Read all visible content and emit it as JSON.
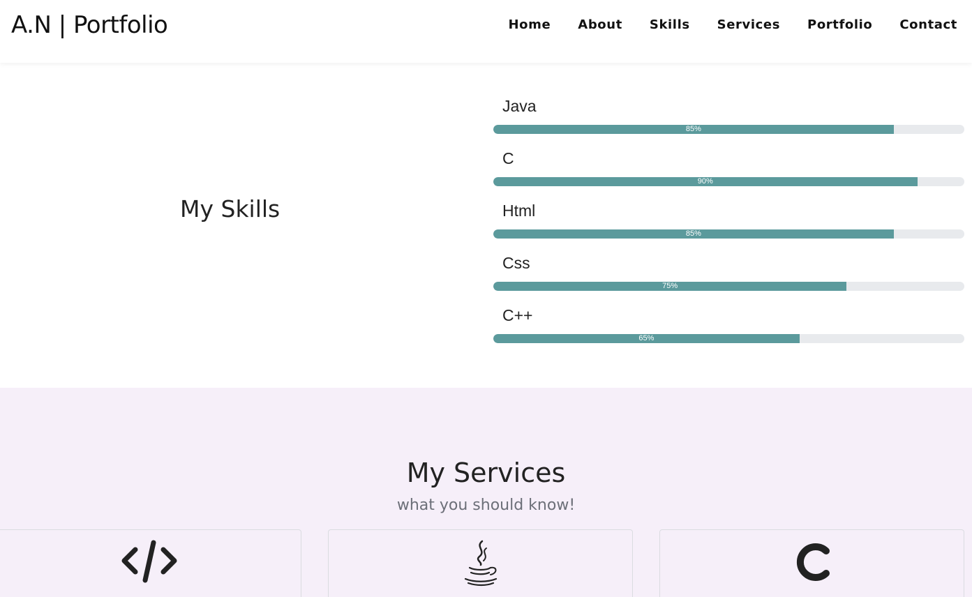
{
  "navbar": {
    "brand": "A.N | Portfolio",
    "links": [
      "Home",
      "About",
      "Skills",
      "Services",
      "Portfolio",
      "Contact"
    ]
  },
  "skills": {
    "title": "My Skills",
    "items": [
      {
        "name": "Java",
        "percent": 85,
        "label": "85%"
      },
      {
        "name": "C",
        "percent": 90,
        "label": "90%"
      },
      {
        "name": "Html",
        "percent": 85,
        "label": "85%"
      },
      {
        "name": "Css",
        "percent": 75,
        "label": "75%"
      },
      {
        "name": "C++",
        "percent": 65,
        "label": "65%"
      }
    ],
    "bar_color": "#5b9a9c",
    "track_color": "#e8eaed"
  },
  "services": {
    "title": "My Services",
    "subtitle": "what you should know!",
    "background": "#f6eff9",
    "cards": [
      {
        "icon": "code-icon"
      },
      {
        "icon": "java-icon"
      },
      {
        "icon": "c-language-icon"
      }
    ]
  }
}
